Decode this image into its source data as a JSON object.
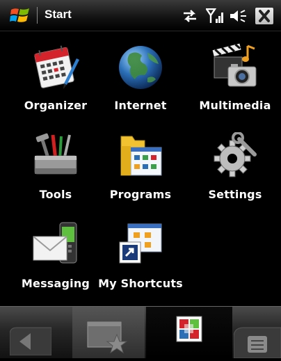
{
  "statusbar": {
    "title": "Start",
    "icons": [
      "windows-logo-icon",
      "sync-icon",
      "signal-icon",
      "volume-icon",
      "close-icon"
    ]
  },
  "tiles": [
    {
      "label": "Organizer",
      "icon": "calendar-icon"
    },
    {
      "label": "Internet",
      "icon": "globe-icon"
    },
    {
      "label": "Multimedia",
      "icon": "media-icon"
    },
    {
      "label": "Tools",
      "icon": "toolbox-icon"
    },
    {
      "label": "Programs",
      "icon": "folder-icon"
    },
    {
      "label": "Settings",
      "icon": "gear-icon"
    },
    {
      "label": "Messaging",
      "icon": "envelope-icon"
    },
    {
      "label": "My Shortcuts",
      "icon": "shortcut-icon"
    }
  ],
  "tabbar": {
    "tabs": [
      "back-icon",
      "favorites-icon",
      "start-icon",
      "menu-icon"
    ],
    "selected": "start-icon"
  },
  "colors": {
    "background": "#000000",
    "text": "#ffffff",
    "calendar_red": "#d4232a",
    "globe_blue": "#2b6fb7",
    "folder_yellow": "#f2c230"
  }
}
